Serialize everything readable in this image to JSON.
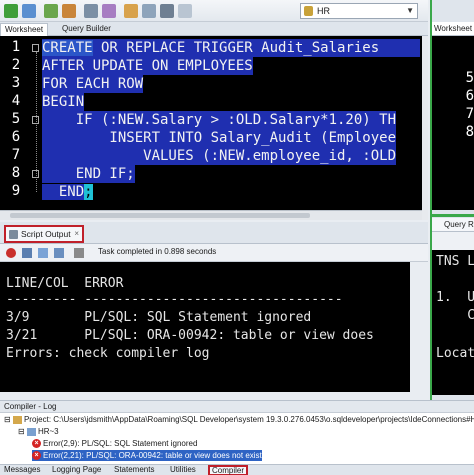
{
  "toolbar": {
    "connection": "HR",
    "icons": [
      "play-icon",
      "run-script-icon",
      "commit-icon",
      "rollback-icon",
      "explain-icon",
      "autotrace-icon",
      "eraser-icon",
      "format-icon",
      "history-icon",
      "database-icon"
    ]
  },
  "tabs": {
    "worksheet": "Worksheet",
    "query_builder": "Query Builder"
  },
  "editor": {
    "line_numbers": [
      "1",
      "2",
      "3",
      "4",
      "5",
      "6",
      "7",
      "8",
      "9"
    ],
    "lines": [
      {
        "kw": "CREATE",
        "rest": " OR REPLACE TRIGGER Audit_Salaries"
      },
      {
        "text": "AFTER UPDATE ON EMPLOYEES"
      },
      {
        "text": "FOR EACH ROW"
      },
      {
        "text": "BEGIN"
      },
      {
        "text": "    IF (:NEW.Salary > :OLD.Salary*1.20) TH"
      },
      {
        "text": "        INSERT INTO Salary_Audit (Employee"
      },
      {
        "text": "            VALUES (:NEW.employee_id, :OLD"
      },
      {
        "text": "    END IF;"
      },
      {
        "text": "  END",
        "cursor": ";"
      }
    ]
  },
  "script_output": {
    "tab_label": "Script Output",
    "status": "Task completed in 0.898 seconds",
    "lines": [
      "",
      "LINE/COL  ERROR",
      "--------- ---------------------------------",
      "3/9       PL/SQL: SQL Statement ignored",
      "3/21      PL/SQL: ORA-00942: table or view does",
      "Errors: check compiler log"
    ]
  },
  "right_panel": {
    "worksheet_tab": "Worksheet",
    "line_numbers": [
      "5",
      "6",
      "7",
      "8"
    ],
    "query_tab": "Query Re",
    "output_lines": [
      "TNS L",
      "",
      "1.  U",
      "    C",
      "",
      "Locat"
    ]
  },
  "compiler_log": {
    "title": "Compiler - Log",
    "project": "Project: C:\\Users\\jdsmith\\AppData\\Roaming\\SQL Developer\\system 19.3.0.276.0453\\o.sqldeveloper\\projects\\IdeConnections#HR.jpr",
    "node": "HR~3",
    "errors": [
      "Error(2,9): PL/SQL: SQL Statement ignored",
      "Error(2,21): PL/SQL: ORA-00942: table or view does not exist"
    ]
  },
  "bottom_tabs": [
    "Messages",
    "Logging Page",
    "Statements",
    "Utilities",
    "Compiler"
  ],
  "colors": {
    "editor_bg": "#000000",
    "selection": "#1f2fb0",
    "highlight_box": "#c0202a",
    "error": "#d42424",
    "selected_row": "#2e63c4"
  }
}
